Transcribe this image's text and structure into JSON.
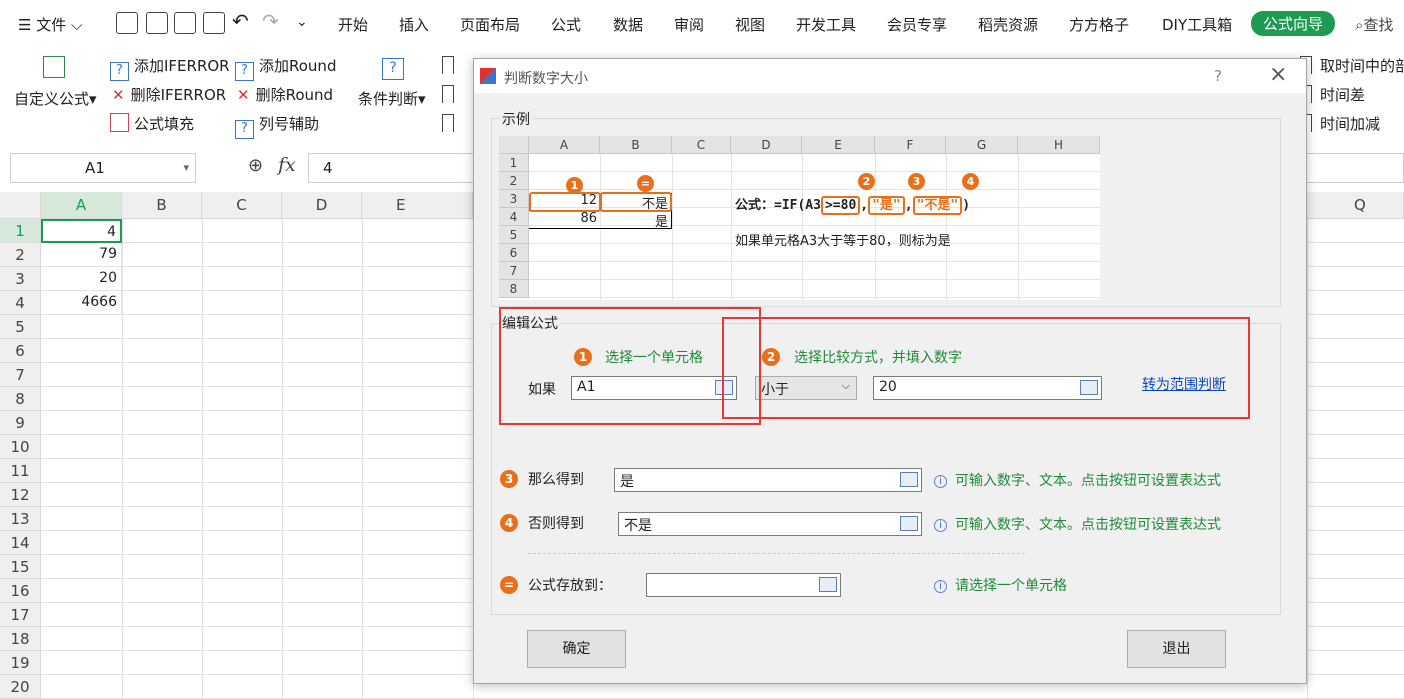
{
  "menu": {
    "file": "文件",
    "tabs": [
      "开始",
      "插入",
      "页面布局",
      "公式",
      "数据",
      "审阅",
      "视图",
      "开发工具",
      "会员专享",
      "稻壳资源",
      "方方格子",
      "DIY工具箱"
    ],
    "active_tab": "公式向导",
    "search": "查找"
  },
  "ribbon": {
    "custom": "自定义公式",
    "add_iferror": "添加IFERROR",
    "add_round": "添加Round",
    "del_iferror": "删除IFERROR",
    "del_round": "删除Round",
    "fill": "公式填充",
    "col_assist": "列号辅助",
    "cond": "条件判断",
    "r1": "取时间中的部",
    "r2": "时间差",
    "r3": "时间加减"
  },
  "formula_bar": {
    "name_box": "A1",
    "fx": "fx",
    "value": "4"
  },
  "sheet": {
    "columns": [
      "A",
      "B",
      "C",
      "D",
      "E",
      "Q"
    ],
    "rows": [
      "1",
      "2",
      "3",
      "4",
      "5",
      "6",
      "7",
      "8",
      "9",
      "10",
      "11",
      "12",
      "13",
      "14",
      "15",
      "16",
      "17",
      "18",
      "19",
      "20"
    ],
    "cells": [
      "4",
      "79",
      "20",
      "4666"
    ]
  },
  "dialog": {
    "title": "判断数字大小",
    "help": "?",
    "close": "×",
    "example": {
      "label": "示例",
      "cols": [
        "A",
        "B",
        "C",
        "D",
        "E",
        "F",
        "G",
        "H"
      ],
      "rows": [
        "1",
        "2",
        "3",
        "4",
        "5",
        "6",
        "7",
        "8"
      ],
      "a3": "12",
      "b3": "不是",
      "a4": "86",
      "b4": "是",
      "formula_pre": "公式：=IF(A3",
      "cond": ">=80",
      "sep": ",",
      "yes": "\"是\"",
      "no": "\"不是\"",
      "close": ")",
      "desc": "如果单元格A3大于等于80，则标为是",
      "marks": [
        "1",
        "2",
        "3",
        "4",
        "="
      ]
    },
    "edit": {
      "label": "编辑公式",
      "step1": "选择一个单元格",
      "step2": "选择比较方式，并填入数字",
      "if_label": "如果",
      "cell_value": "A1",
      "compare": "小于",
      "number": "20",
      "range_link": "转为范围判断"
    },
    "then": {
      "label": "那么得到",
      "value": "是",
      "hint": "可输入数字、文本。点击按钮可设置表达式"
    },
    "else": {
      "label": "否则得到",
      "value": "不是",
      "hint": "可输入数字、文本。点击按钮可设置表达式"
    },
    "store": {
      "label": "公式存放到：",
      "value": "",
      "hint": "请选择一个单元格"
    },
    "step_nums": [
      "1",
      "2",
      "3",
      "4",
      "="
    ],
    "ok": "确定",
    "exit": "退出"
  },
  "colors": {
    "accent": "#1e9b52",
    "orange": "#e8701a",
    "red": "#e53935"
  }
}
